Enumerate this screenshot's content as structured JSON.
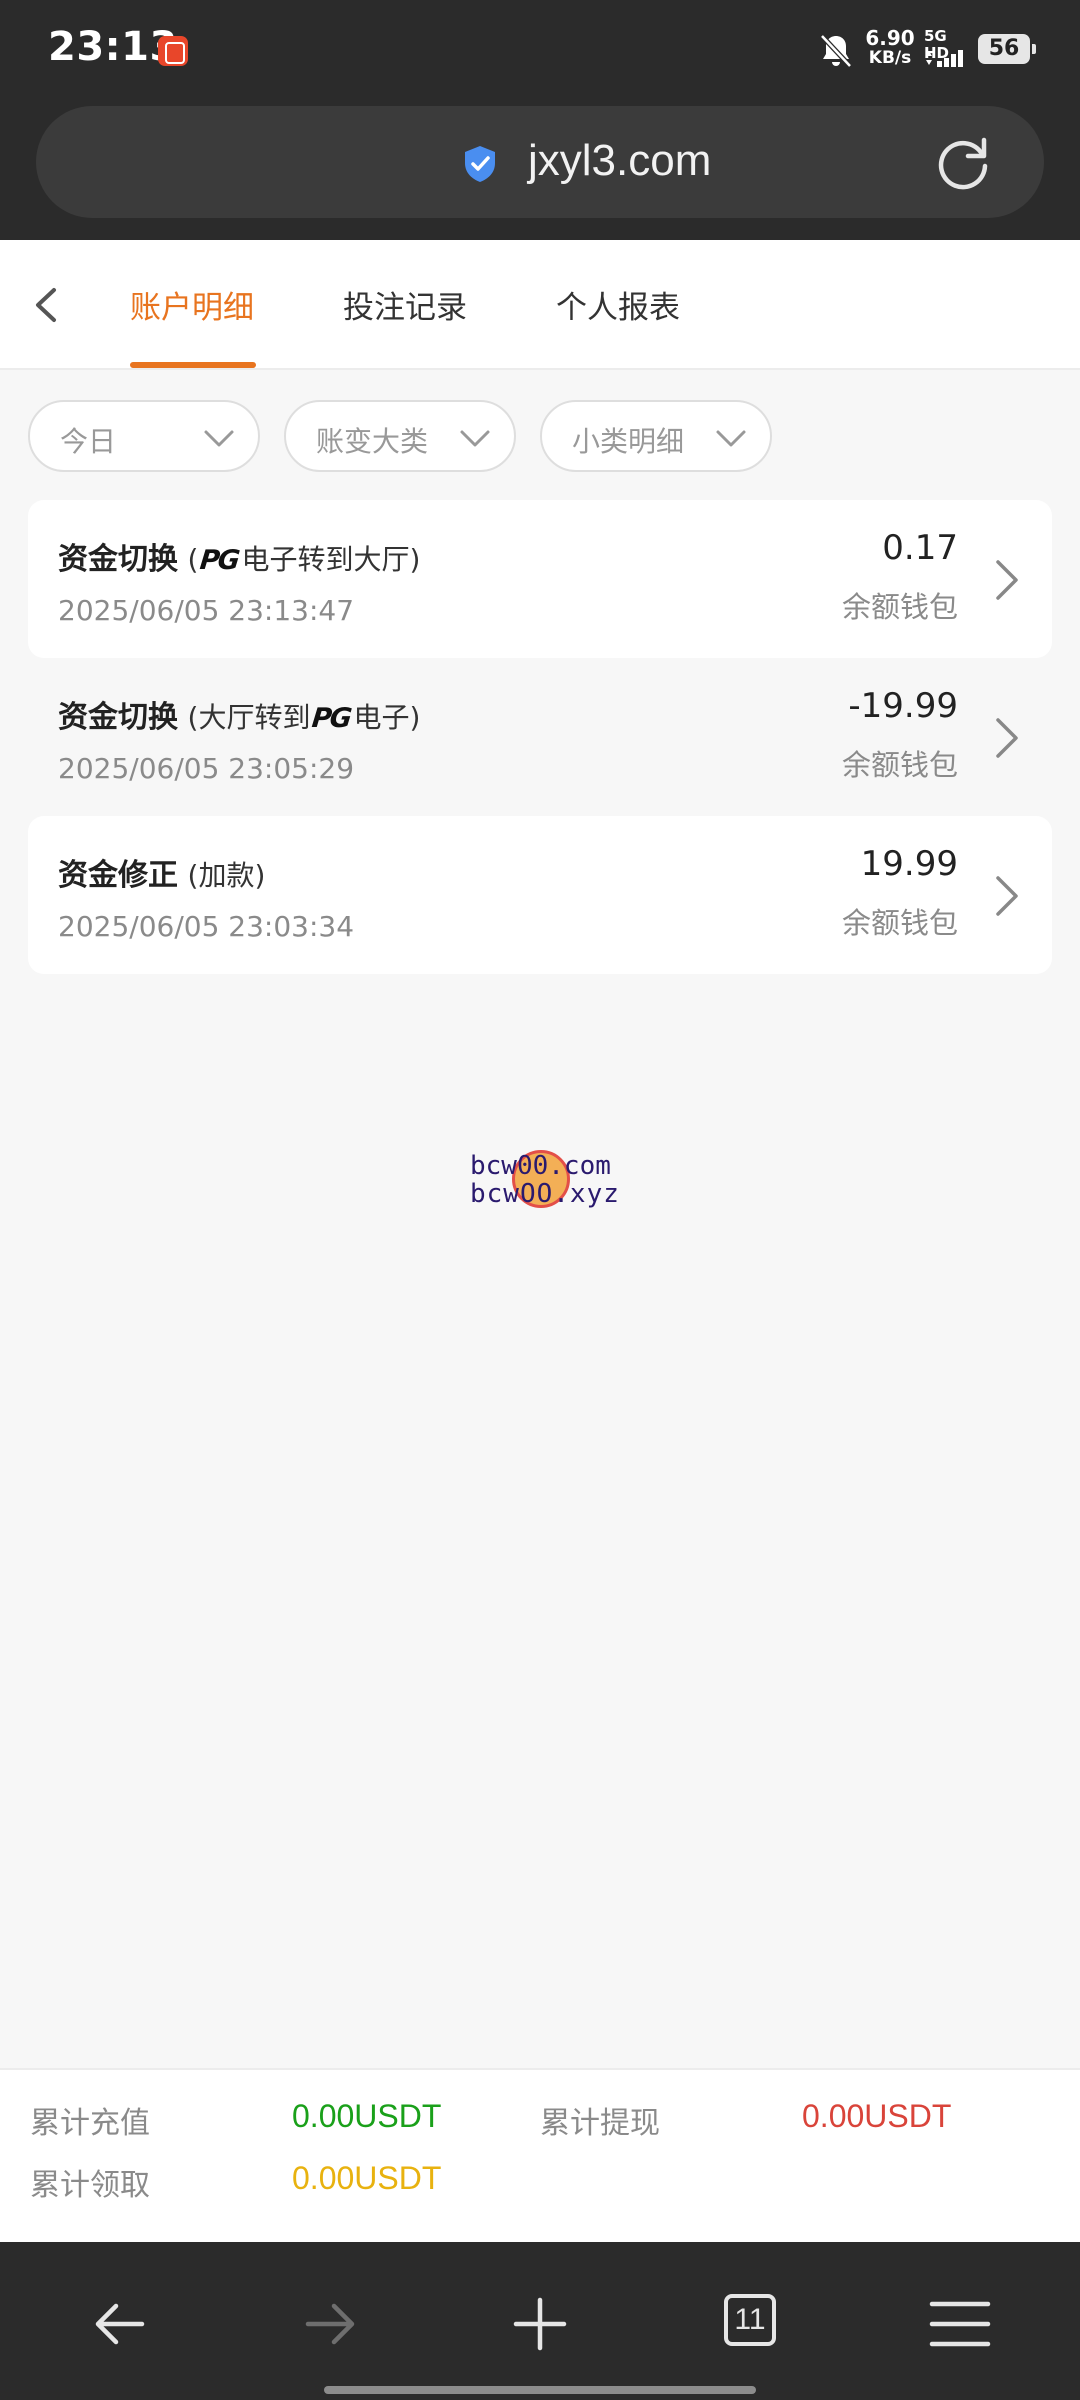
{
  "status_bar": {
    "time": "23:13",
    "net_speed_value": "6.90",
    "net_speed_unit": "KB/s",
    "network": "5G HD",
    "battery": "56"
  },
  "browser": {
    "url": "jxyl3.com",
    "tabs_count": "11"
  },
  "tabs": [
    {
      "label": "账户明细",
      "active": true
    },
    {
      "label": "投注记录",
      "active": false
    },
    {
      "label": "个人报表",
      "active": false
    }
  ],
  "filters": [
    {
      "label": "今日"
    },
    {
      "label": "账变大类"
    },
    {
      "label": "小类明细"
    }
  ],
  "transactions": [
    {
      "title": "资金切换",
      "detail_open": "(",
      "detail_logo": "PG",
      "detail_text": "电子转到大厅)",
      "time": "2025/06/05 23:13:47",
      "amount": "0.17",
      "wallet": "余额钱包"
    },
    {
      "title": "资金切换",
      "detail_text": "(大厅转到",
      "detail_logo": "PG",
      "detail_close": "电子)",
      "time": "2025/06/05 23:05:29",
      "amount": "-19.99",
      "wallet": "余额钱包"
    },
    {
      "title": "资金修正",
      "detail_text": "(加款)",
      "time": "2025/06/05 23:03:34",
      "amount": "19.99",
      "wallet": "余额钱包"
    }
  ],
  "watermark": {
    "line1": "bcw00.com",
    "line2": "bcwOO.xyz"
  },
  "summary": {
    "recharge_label": "累计充值",
    "recharge_value": "0.00USDT",
    "withdraw_label": "累计提现",
    "withdraw_value": "0.00USDT",
    "claim_label": "累计领取",
    "claim_value": "0.00USDT",
    "colors": {
      "recharge": "#1aa01a",
      "withdraw": "#d9443a",
      "claim": "#e8b20f"
    }
  },
  "colors": {
    "accent": "#e8741f",
    "chrome": "#2b2b2b"
  },
  "icons": {
    "back": "chevron-left-icon",
    "filter_caret": "chevron-down-icon",
    "row_arrow": "chevron-right-icon",
    "secure": "shield-check-icon",
    "reload": "reload-icon",
    "nav": [
      "arrow-left-icon",
      "arrow-right-icon",
      "plus-icon",
      "tabs-icon",
      "menu-icon"
    ]
  }
}
